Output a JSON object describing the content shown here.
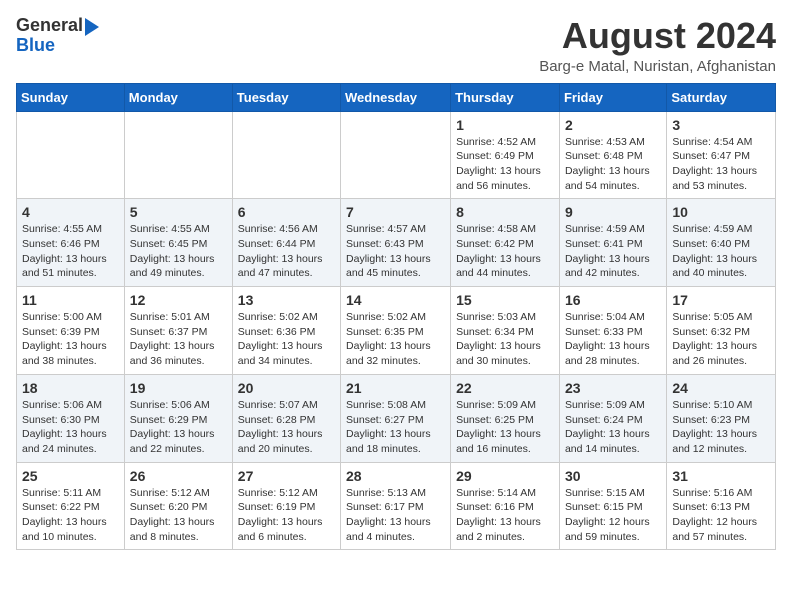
{
  "header": {
    "logo_line1": "General",
    "logo_line2": "Blue",
    "month_title": "August 2024",
    "location": "Barg-e Matal, Nuristan, Afghanistan"
  },
  "weekdays": [
    "Sunday",
    "Monday",
    "Tuesday",
    "Wednesday",
    "Thursday",
    "Friday",
    "Saturday"
  ],
  "weeks": [
    [
      {
        "day": "",
        "info": ""
      },
      {
        "day": "",
        "info": ""
      },
      {
        "day": "",
        "info": ""
      },
      {
        "day": "",
        "info": ""
      },
      {
        "day": "1",
        "info": "Sunrise: 4:52 AM\nSunset: 6:49 PM\nDaylight: 13 hours\nand 56 minutes."
      },
      {
        "day": "2",
        "info": "Sunrise: 4:53 AM\nSunset: 6:48 PM\nDaylight: 13 hours\nand 54 minutes."
      },
      {
        "day": "3",
        "info": "Sunrise: 4:54 AM\nSunset: 6:47 PM\nDaylight: 13 hours\nand 53 minutes."
      }
    ],
    [
      {
        "day": "4",
        "info": "Sunrise: 4:55 AM\nSunset: 6:46 PM\nDaylight: 13 hours\nand 51 minutes."
      },
      {
        "day": "5",
        "info": "Sunrise: 4:55 AM\nSunset: 6:45 PM\nDaylight: 13 hours\nand 49 minutes."
      },
      {
        "day": "6",
        "info": "Sunrise: 4:56 AM\nSunset: 6:44 PM\nDaylight: 13 hours\nand 47 minutes."
      },
      {
        "day": "7",
        "info": "Sunrise: 4:57 AM\nSunset: 6:43 PM\nDaylight: 13 hours\nand 45 minutes."
      },
      {
        "day": "8",
        "info": "Sunrise: 4:58 AM\nSunset: 6:42 PM\nDaylight: 13 hours\nand 44 minutes."
      },
      {
        "day": "9",
        "info": "Sunrise: 4:59 AM\nSunset: 6:41 PM\nDaylight: 13 hours\nand 42 minutes."
      },
      {
        "day": "10",
        "info": "Sunrise: 4:59 AM\nSunset: 6:40 PM\nDaylight: 13 hours\nand 40 minutes."
      }
    ],
    [
      {
        "day": "11",
        "info": "Sunrise: 5:00 AM\nSunset: 6:39 PM\nDaylight: 13 hours\nand 38 minutes."
      },
      {
        "day": "12",
        "info": "Sunrise: 5:01 AM\nSunset: 6:37 PM\nDaylight: 13 hours\nand 36 minutes."
      },
      {
        "day": "13",
        "info": "Sunrise: 5:02 AM\nSunset: 6:36 PM\nDaylight: 13 hours\nand 34 minutes."
      },
      {
        "day": "14",
        "info": "Sunrise: 5:02 AM\nSunset: 6:35 PM\nDaylight: 13 hours\nand 32 minutes."
      },
      {
        "day": "15",
        "info": "Sunrise: 5:03 AM\nSunset: 6:34 PM\nDaylight: 13 hours\nand 30 minutes."
      },
      {
        "day": "16",
        "info": "Sunrise: 5:04 AM\nSunset: 6:33 PM\nDaylight: 13 hours\nand 28 minutes."
      },
      {
        "day": "17",
        "info": "Sunrise: 5:05 AM\nSunset: 6:32 PM\nDaylight: 13 hours\nand 26 minutes."
      }
    ],
    [
      {
        "day": "18",
        "info": "Sunrise: 5:06 AM\nSunset: 6:30 PM\nDaylight: 13 hours\nand 24 minutes."
      },
      {
        "day": "19",
        "info": "Sunrise: 5:06 AM\nSunset: 6:29 PM\nDaylight: 13 hours\nand 22 minutes."
      },
      {
        "day": "20",
        "info": "Sunrise: 5:07 AM\nSunset: 6:28 PM\nDaylight: 13 hours\nand 20 minutes."
      },
      {
        "day": "21",
        "info": "Sunrise: 5:08 AM\nSunset: 6:27 PM\nDaylight: 13 hours\nand 18 minutes."
      },
      {
        "day": "22",
        "info": "Sunrise: 5:09 AM\nSunset: 6:25 PM\nDaylight: 13 hours\nand 16 minutes."
      },
      {
        "day": "23",
        "info": "Sunrise: 5:09 AM\nSunset: 6:24 PM\nDaylight: 13 hours\nand 14 minutes."
      },
      {
        "day": "24",
        "info": "Sunrise: 5:10 AM\nSunset: 6:23 PM\nDaylight: 13 hours\nand 12 minutes."
      }
    ],
    [
      {
        "day": "25",
        "info": "Sunrise: 5:11 AM\nSunset: 6:22 PM\nDaylight: 13 hours\nand 10 minutes."
      },
      {
        "day": "26",
        "info": "Sunrise: 5:12 AM\nSunset: 6:20 PM\nDaylight: 13 hours\nand 8 minutes."
      },
      {
        "day": "27",
        "info": "Sunrise: 5:12 AM\nSunset: 6:19 PM\nDaylight: 13 hours\nand 6 minutes."
      },
      {
        "day": "28",
        "info": "Sunrise: 5:13 AM\nSunset: 6:17 PM\nDaylight: 13 hours\nand 4 minutes."
      },
      {
        "day": "29",
        "info": "Sunrise: 5:14 AM\nSunset: 6:16 PM\nDaylight: 13 hours\nand 2 minutes."
      },
      {
        "day": "30",
        "info": "Sunrise: 5:15 AM\nSunset: 6:15 PM\nDaylight: 12 hours\nand 59 minutes."
      },
      {
        "day": "31",
        "info": "Sunrise: 5:16 AM\nSunset: 6:13 PM\nDaylight: 12 hours\nand 57 minutes."
      }
    ]
  ]
}
